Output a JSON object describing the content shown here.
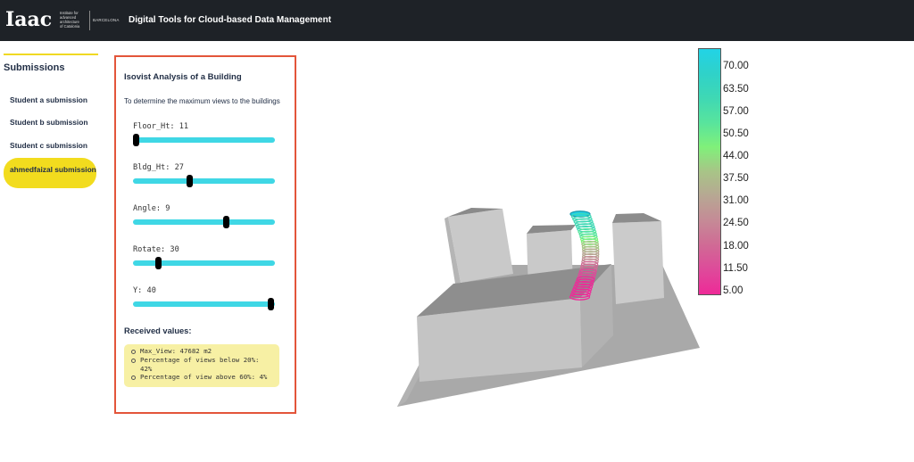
{
  "header": {
    "logo_mark": "Iaac",
    "logo_sub_lines": [
      "Institute for",
      "advanced",
      "architecture",
      "of Catalonia"
    ],
    "logo_city": "BARCELONA",
    "title": "Digital Tools for Cloud-based Data Management"
  },
  "sidebar": {
    "heading": "Submissions",
    "items": [
      {
        "label": "Student a submission",
        "active": false
      },
      {
        "label": "Student b submission",
        "active": false
      },
      {
        "label": "Student c submission",
        "active": false
      },
      {
        "label": "ahmedfaizal submission",
        "active": true
      }
    ]
  },
  "panel": {
    "title": "Isovist Analysis of a Building",
    "description": "To determine the maximum views to the buildings",
    "sliders": [
      {
        "label": "Floor_Ht: 11",
        "position_pct": 2
      },
      {
        "label": "Bldg_Ht: 27",
        "position_pct": 40
      },
      {
        "label": "Angle: 9",
        "position_pct": 66
      },
      {
        "label": "Rotate: 30",
        "position_pct": 18
      },
      {
        "label": "Y: 40",
        "position_pct": 97
      }
    ],
    "received_title": "Received values:",
    "received_values": [
      "Max_View: 47682 m2",
      "Percentage of views below 20%: 42%",
      "Percentage of view above 60%: 4%"
    ]
  },
  "legend": {
    "labels": [
      "70.00",
      "63.50",
      "57.00",
      "50.50",
      "44.00",
      "37.50",
      "31.00",
      "24.50",
      "18.00",
      "11.50",
      "5.00"
    ],
    "colors": [
      "#22d3e6",
      "#2fd2c9",
      "#3fd8b4",
      "#58e49d",
      "#80f07a",
      "#a8c487",
      "#b7a793",
      "#c58a96",
      "#d06a95",
      "#de4a9a",
      "#ee2a98"
    ]
  },
  "colors": {
    "header_bg": "#1e2227",
    "accent_yellow": "#f2dc1e",
    "panel_border": "#e3553a",
    "slider_track": "#3fd7e5"
  }
}
